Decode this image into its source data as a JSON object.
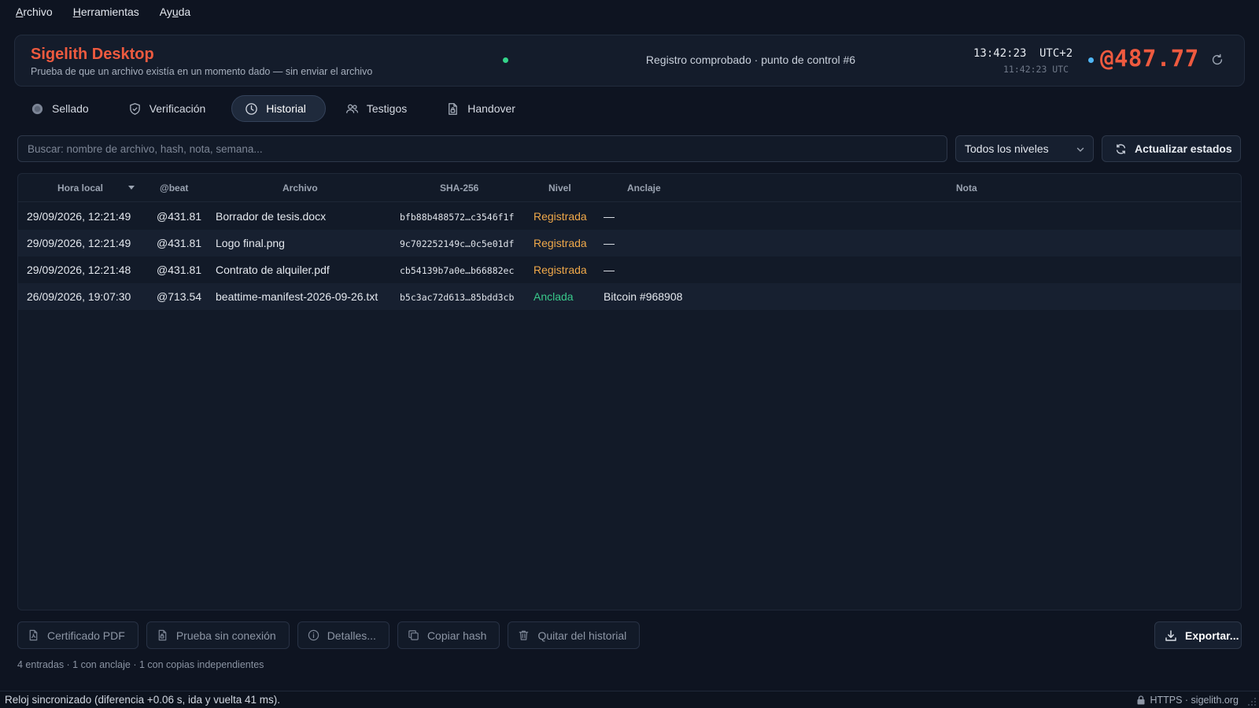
{
  "menubar": {
    "items": [
      {
        "accel": "A",
        "rest": "rchivo"
      },
      {
        "accel": "H",
        "rest": "erramientas"
      },
      {
        "pre": "Ay",
        "accel": "u",
        "rest": "da"
      }
    ]
  },
  "header": {
    "title": "Sigelith Desktop",
    "subtitle": "Prueba de que un archivo existía en un momento dado — sin enviar el archivo",
    "status_text": "Registro comprobado · punto de control #6",
    "local_time": "13:42:23",
    "timezone": "UTC+2",
    "utc_time": "11:42:23 UTC",
    "beat": "@487.77",
    "colors": {
      "brand": "#ee5a3f",
      "status_dot": "#34d48a",
      "beat_dot": "#4fb6f5"
    }
  },
  "tabs": [
    {
      "label": "Sellado",
      "icon": "seal-icon",
      "active": false
    },
    {
      "label": "Verificación",
      "icon": "shield-check-icon",
      "active": false
    },
    {
      "label": "Historial",
      "icon": "clock-icon",
      "active": true
    },
    {
      "label": "Testigos",
      "icon": "users-icon",
      "active": false
    },
    {
      "label": "Handover",
      "icon": "document-lock-icon",
      "active": false
    }
  ],
  "search": {
    "placeholder": "Buscar: nombre de archivo, hash, nota, semana...",
    "value": ""
  },
  "level_filter": {
    "selected": "Todos los niveles"
  },
  "update_button": "Actualizar estados",
  "table": {
    "headers": {
      "local_time": "Hora local",
      "beat": "@beat",
      "file": "Archivo",
      "sha": "SHA-256",
      "level": "Nivel",
      "anchor": "Anclaje",
      "note": "Nota"
    },
    "rows": [
      {
        "local_time": "29/09/2026, 12:21:49",
        "beat": "@431.81",
        "file": "Borrador de tesis.docx",
        "sha": "bfb88b488572…c3546f1f",
        "level": "Registrada",
        "level_kind": "reg",
        "anchor": "—",
        "note": ""
      },
      {
        "local_time": "29/09/2026, 12:21:49",
        "beat": "@431.81",
        "file": "Logo final.png",
        "sha": "9c702252149c…0c5e01df",
        "level": "Registrada",
        "level_kind": "reg",
        "anchor": "—",
        "note": ""
      },
      {
        "local_time": "29/09/2026, 12:21:48",
        "beat": "@431.81",
        "file": "Contrato de alquiler.pdf",
        "sha": "cb54139b7a0e…b66882ec",
        "level": "Registrada",
        "level_kind": "reg",
        "anchor": "—",
        "note": ""
      },
      {
        "local_time": "26/09/2026, 19:07:30",
        "beat": "@713.54",
        "file": "beattime-manifest-2026-09-26.txt",
        "sha": "b5c3ac72d613…85bdd3cb",
        "level": "Anclada",
        "level_kind": "anc",
        "anchor": "Bitcoin #968908",
        "note": ""
      }
    ]
  },
  "actions": [
    {
      "label": "Certificado PDF",
      "icon": "pdf-file-icon",
      "name": "pdf-certificate-button"
    },
    {
      "label": "Prueba sin conexión",
      "icon": "offline-file-icon",
      "name": "offline-proof-button"
    },
    {
      "label": "Detalles...",
      "icon": "info-icon",
      "name": "details-button"
    },
    {
      "label": "Copiar hash",
      "icon": "copy-icon",
      "name": "copy-hash-button"
    },
    {
      "label": "Quitar del historial",
      "icon": "trash-icon",
      "name": "remove-history-button"
    }
  ],
  "export_button": "Exportar...",
  "summary": "4 entradas · 1 con anclaje · 1 con copias independientes",
  "statusbar": {
    "left": "Reloj sincronizado (diferencia +0.06 s, ida y vuelta 41 ms).",
    "right": "HTTPS · sigelith.org"
  }
}
